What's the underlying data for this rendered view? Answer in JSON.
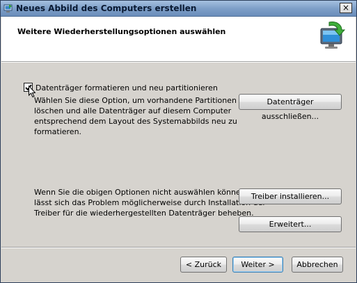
{
  "window": {
    "title": "Neues Abbild des Computers erstellen",
    "close_label": "×"
  },
  "header": {
    "title": "Weitere Wiederherstellungsoptionen auswählen"
  },
  "format_option": {
    "checkbox_label": "Datenträger formatieren und neu partitionieren",
    "checked": true,
    "description_lines": [
      "Wählen Sie diese Option, um vorhandene Partitionen zu",
      "löschen und alle Datenträger auf diesem Computer",
      "entsprechend dem Layout des Systemabbilds neu zu",
      "formatieren."
    ],
    "exclude_button": "Datenträger ausschließen..."
  },
  "driver_info": {
    "lines": [
      "Wenn Sie die obigen Optionen nicht auswählen können,",
      "lässt sich das Problem möglicherweise durch Installation der",
      "Treiber für die wiederhergestellten Datenträger beheben."
    ],
    "install_button": "Treiber installieren...",
    "advanced_button": "Erweitert..."
  },
  "footer": {
    "back_button": "< Zurück",
    "next_button": "Weiter >",
    "cancel_button": "Abbrechen"
  },
  "colors": {
    "dialog_bg": "#d6d3ce",
    "titlebar": "#7e9fc8",
    "header_bg": "#ffffff",
    "default_button_border": "#3c7fb1"
  },
  "icons": {
    "title": "restore-icon",
    "header": "computer-restore-icon"
  }
}
